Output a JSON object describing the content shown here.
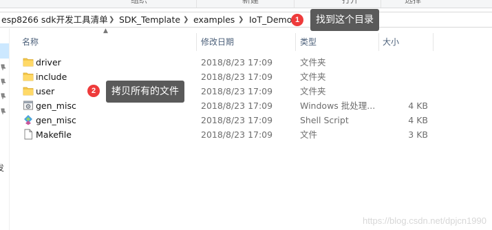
{
  "ribbon": {
    "groups": [
      "组织",
      "新建",
      "打开",
      "选择"
    ]
  },
  "breadcrumb": {
    "items": [
      "esp8266 sdk开发工具清单",
      "SDK_Template",
      "examples",
      "IoT_Demo"
    ]
  },
  "columns": {
    "name": "名称",
    "date": "修改日期",
    "type": "类型",
    "size": "大小"
  },
  "files": [
    {
      "name": "driver",
      "date": "2018/8/23 17:09",
      "type": "文件夹",
      "size": "",
      "icon": "folder-icon"
    },
    {
      "name": "include",
      "date": "2018/8/23 17:09",
      "type": "文件夹",
      "size": "",
      "icon": "folder-icon"
    },
    {
      "name": "user",
      "date": "2018/8/23 17:09",
      "type": "文件夹",
      "size": "",
      "icon": "folder-icon"
    },
    {
      "name": "gen_misc",
      "date": "2018/8/23 17:09",
      "type": "Windows 批处理...",
      "size": "4 KB",
      "icon": "batch-file-icon"
    },
    {
      "name": "gen_misc",
      "date": "2018/8/23 17:09",
      "type": "Shell Script",
      "size": "4 KB",
      "icon": "shell-script-icon"
    },
    {
      "name": "Makefile",
      "date": "2018/8/23 17:09",
      "type": "文件",
      "size": "3 KB",
      "icon": "file-icon"
    }
  ],
  "annotations": [
    {
      "number": "1",
      "text": "找到这个目录"
    },
    {
      "number": "2",
      "text": "拷贝所有的文件"
    }
  ],
  "nav": {
    "cut_text": "发"
  },
  "watermark": "https://blog.csdn.net/dpjcn1990",
  "colors": {
    "badge": "#ee3b3b",
    "callout": "#5a5a5a",
    "folder": "#f4c84a",
    "header_text": "#4c607a"
  }
}
